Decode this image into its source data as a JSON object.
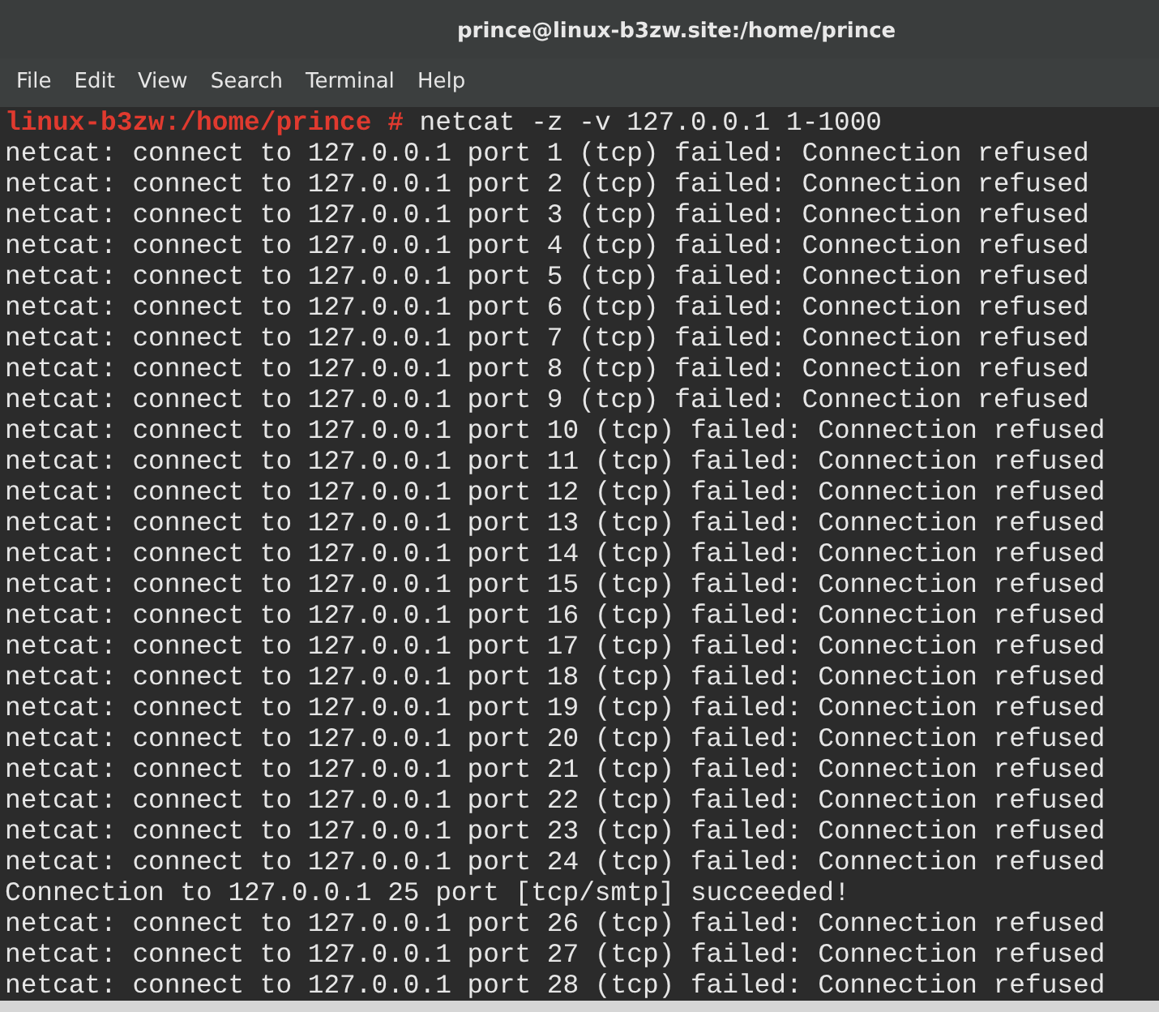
{
  "window": {
    "title": "prince@linux-b3zw.site:/home/prince"
  },
  "menu": [
    "File",
    "Edit",
    "View",
    "Search",
    "Terminal",
    "Help"
  ],
  "prompt": {
    "text": "linux-b3zw:/home/prince #",
    "command": "netcat -z -v 127.0.0.1 1-1000"
  },
  "output": [
    "netcat: connect to 127.0.0.1 port 1 (tcp) failed: Connection refused",
    "netcat: connect to 127.0.0.1 port 2 (tcp) failed: Connection refused",
    "netcat: connect to 127.0.0.1 port 3 (tcp) failed: Connection refused",
    "netcat: connect to 127.0.0.1 port 4 (tcp) failed: Connection refused",
    "netcat: connect to 127.0.0.1 port 5 (tcp) failed: Connection refused",
    "netcat: connect to 127.0.0.1 port 6 (tcp) failed: Connection refused",
    "netcat: connect to 127.0.0.1 port 7 (tcp) failed: Connection refused",
    "netcat: connect to 127.0.0.1 port 8 (tcp) failed: Connection refused",
    "netcat: connect to 127.0.0.1 port 9 (tcp) failed: Connection refused",
    "netcat: connect to 127.0.0.1 port 10 (tcp) failed: Connection refused",
    "netcat: connect to 127.0.0.1 port 11 (tcp) failed: Connection refused",
    "netcat: connect to 127.0.0.1 port 12 (tcp) failed: Connection refused",
    "netcat: connect to 127.0.0.1 port 13 (tcp) failed: Connection refused",
    "netcat: connect to 127.0.0.1 port 14 (tcp) failed: Connection refused",
    "netcat: connect to 127.0.0.1 port 15 (tcp) failed: Connection refused",
    "netcat: connect to 127.0.0.1 port 16 (tcp) failed: Connection refused",
    "netcat: connect to 127.0.0.1 port 17 (tcp) failed: Connection refused",
    "netcat: connect to 127.0.0.1 port 18 (tcp) failed: Connection refused",
    "netcat: connect to 127.0.0.1 port 19 (tcp) failed: Connection refused",
    "netcat: connect to 127.0.0.1 port 20 (tcp) failed: Connection refused",
    "netcat: connect to 127.0.0.1 port 21 (tcp) failed: Connection refused",
    "netcat: connect to 127.0.0.1 port 22 (tcp) failed: Connection refused",
    "netcat: connect to 127.0.0.1 port 23 (tcp) failed: Connection refused",
    "netcat: connect to 127.0.0.1 port 24 (tcp) failed: Connection refused",
    "Connection to 127.0.0.1 25 port [tcp/smtp] succeeded!",
    "netcat: connect to 127.0.0.1 port 26 (tcp) failed: Connection refused",
    "netcat: connect to 127.0.0.1 port 27 (tcp) failed: Connection refused",
    "netcat: connect to 127.0.0.1 port 28 (tcp) failed: Connection refused"
  ]
}
